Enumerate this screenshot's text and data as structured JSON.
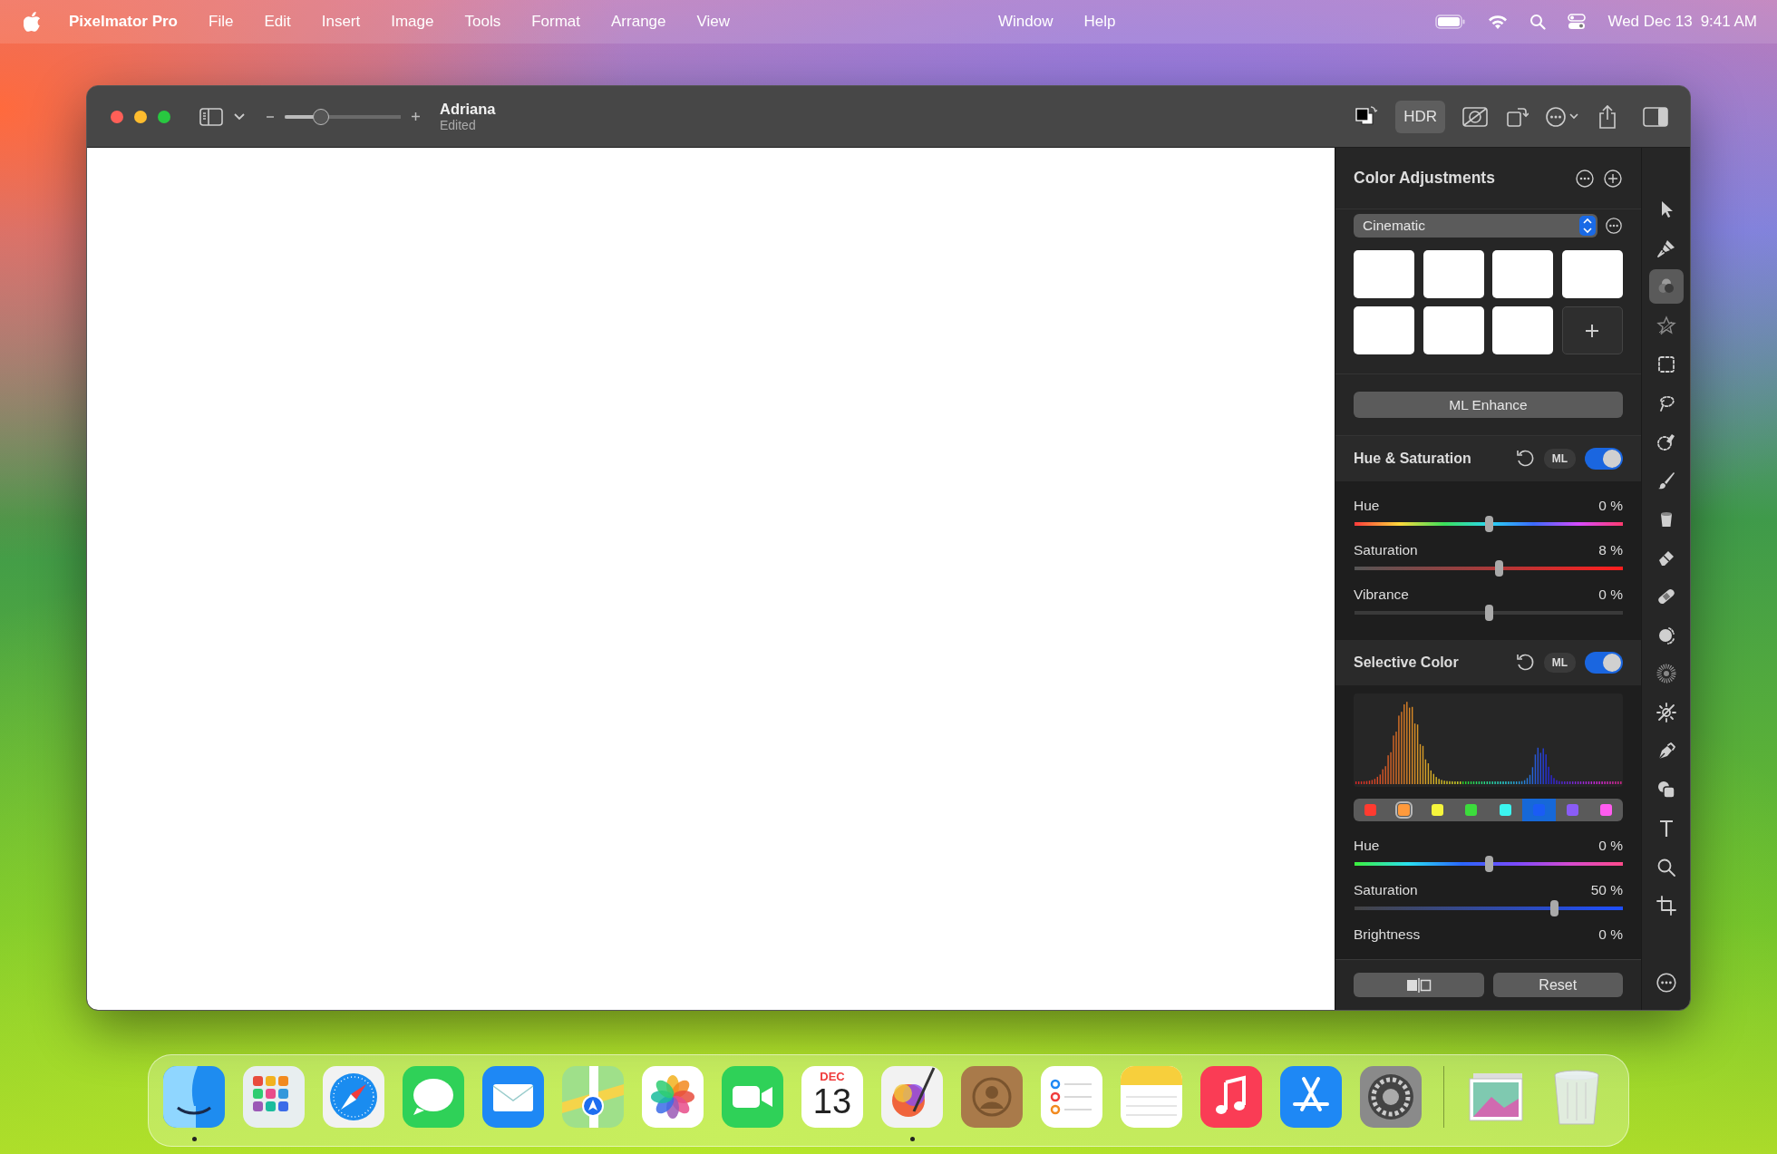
{
  "menu_bar": {
    "app_name": "Pixelmator Pro",
    "menus": [
      "File",
      "Edit",
      "Insert",
      "Image",
      "Tools",
      "Format",
      "Arrange",
      "View"
    ],
    "menus_right": [
      "Window",
      "Help"
    ],
    "date": "Wed Dec 13",
    "time": "9:41 AM"
  },
  "window": {
    "title": "Adriana",
    "subtitle": "Edited",
    "zoom": {
      "level": 0.31
    },
    "hdr": {
      "label": "HDR",
      "on": true
    }
  },
  "panel": {
    "title": "Color Adjustments",
    "preset": "Cinematic",
    "ml_enhance": "ML Enhance",
    "sections": [
      {
        "title": "Hue & Saturation",
        "ml": "ML",
        "on": true,
        "sliders": [
          {
            "kind": "hue",
            "label": "Hue",
            "reading": "0 %",
            "level": 0.5
          },
          {
            "kind": "red",
            "label": "Saturation",
            "reading": "8 %",
            "level": 0.54
          },
          {
            "kind": "plain",
            "label": "Vibrance",
            "reading": "0 %",
            "level": 0.5
          }
        ]
      },
      {
        "title": "Selective Color",
        "ml": "ML",
        "on": true,
        "swatches": [
          {
            "color": "#ff3b30",
            "selected": false,
            "edited": false
          },
          {
            "color": "#ff9a3c",
            "selected": false,
            "edited": true
          },
          {
            "color": "#f5f53c",
            "selected": false,
            "edited": false
          },
          {
            "color": "#3cdc3c",
            "selected": false,
            "edited": false
          },
          {
            "color": "#3cf5f0",
            "selected": false,
            "edited": false
          },
          {
            "color": "#1a5cf5",
            "selected": true,
            "edited": false
          },
          {
            "color": "#8a5cf5",
            "selected": false,
            "edited": false
          },
          {
            "color": "#ff5cf0",
            "selected": false,
            "edited": false
          }
        ],
        "sliders": [
          {
            "kind": "hue_shift",
            "label": "Hue",
            "reading": "0 %",
            "level": 0.5
          },
          {
            "kind": "blue",
            "label": "Saturation",
            "reading": "50 %",
            "level": 0.745
          },
          {
            "label": "Brightness",
            "reading": "0 %"
          }
        ]
      }
    ],
    "reset": "Reset"
  },
  "tools": [
    {
      "kind": "pointer",
      "selected": false
    },
    {
      "kind": "style",
      "selected": false
    },
    {
      "kind": "color",
      "selected": true
    },
    {
      "kind": "effects",
      "selected": false
    },
    {
      "kind": "rect_select",
      "selected": false
    },
    {
      "kind": "lasso",
      "selected": false
    },
    {
      "kind": "quick_select",
      "selected": false
    },
    {
      "kind": "paint",
      "selected": false
    },
    {
      "kind": "fill",
      "selected": false
    },
    {
      "kind": "erase",
      "selected": false
    },
    {
      "kind": "repair",
      "selected": false
    },
    {
      "kind": "clone",
      "selected": false
    },
    {
      "kind": "noise",
      "selected": false
    },
    {
      "kind": "light",
      "selected": false
    },
    {
      "kind": "pen",
      "selected": false
    },
    {
      "kind": "shapes",
      "selected": false
    },
    {
      "kind": "type",
      "selected": false
    },
    {
      "kind": "zoom",
      "selected": false
    },
    {
      "kind": "crop",
      "selected": false
    }
  ],
  "dock": {
    "apps": [
      {
        "kind": "finder",
        "running": true
      },
      {
        "kind": "launchpad",
        "running": false
      },
      {
        "kind": "safari",
        "running": false
      },
      {
        "kind": "messages",
        "running": false
      },
      {
        "kind": "mail",
        "running": false
      },
      {
        "kind": "maps",
        "running": false
      },
      {
        "kind": "photos",
        "running": false
      },
      {
        "kind": "facetime",
        "running": false
      },
      {
        "kind": "calendar",
        "month": "DEC",
        "day": "13",
        "running": false
      },
      {
        "kind": "pixelmator",
        "running": true
      },
      {
        "kind": "contacts",
        "running": false
      },
      {
        "kind": "reminders",
        "running": false
      },
      {
        "kind": "notes",
        "running": false
      },
      {
        "kind": "music",
        "running": false
      },
      {
        "kind": "appstore",
        "running": false
      },
      {
        "kind": "settings",
        "running": false
      }
    ],
    "extras": [
      {
        "kind": "photo_stack"
      },
      {
        "kind": "trash"
      }
    ]
  }
}
